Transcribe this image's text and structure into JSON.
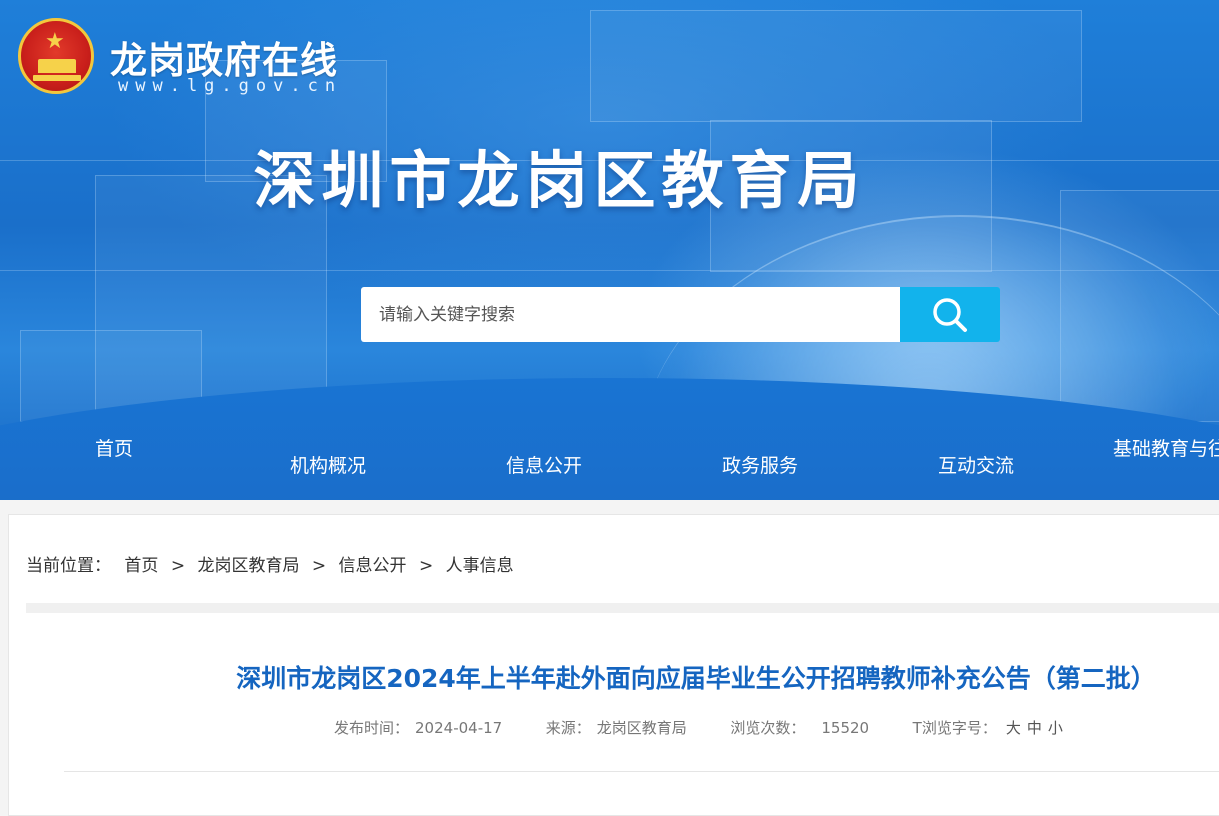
{
  "header": {
    "site_name": "龙岗政府在线",
    "site_url": "www.lg.gov.cn",
    "bureau_title": "深圳市龙岗区教育局"
  },
  "search": {
    "placeholder": "请输入关键字搜索",
    "icon": "search-icon"
  },
  "nav": {
    "items": [
      {
        "label": "首页"
      },
      {
        "label": "机构概况"
      },
      {
        "label": "信息公开"
      },
      {
        "label": "政务服务"
      },
      {
        "label": "互动交流"
      },
      {
        "label": "基础教育与往"
      }
    ]
  },
  "breadcrumb": {
    "prefix": "当前位置：",
    "items": [
      "首页",
      "龙岗区教育局",
      "信息公开",
      "人事信息"
    ],
    "separator": ">"
  },
  "article": {
    "title": "深圳市龙岗区2024年上半年赴外面向应届毕业生公开招聘教师补充公告（第二批）",
    "published_label": "发布时间：",
    "published_value": "2024-04-17",
    "source_label": "来源：",
    "source_value": "龙岗区教育局",
    "views_label": "浏览次数：",
    "views_value": "15520",
    "font_label": "T浏览字号：",
    "font_large": "大",
    "font_medium": "中",
    "font_small": "小"
  },
  "colors": {
    "brand_blue": "#1a6fca",
    "search_button": "#12b3ec",
    "title_blue": "#1565c0"
  }
}
